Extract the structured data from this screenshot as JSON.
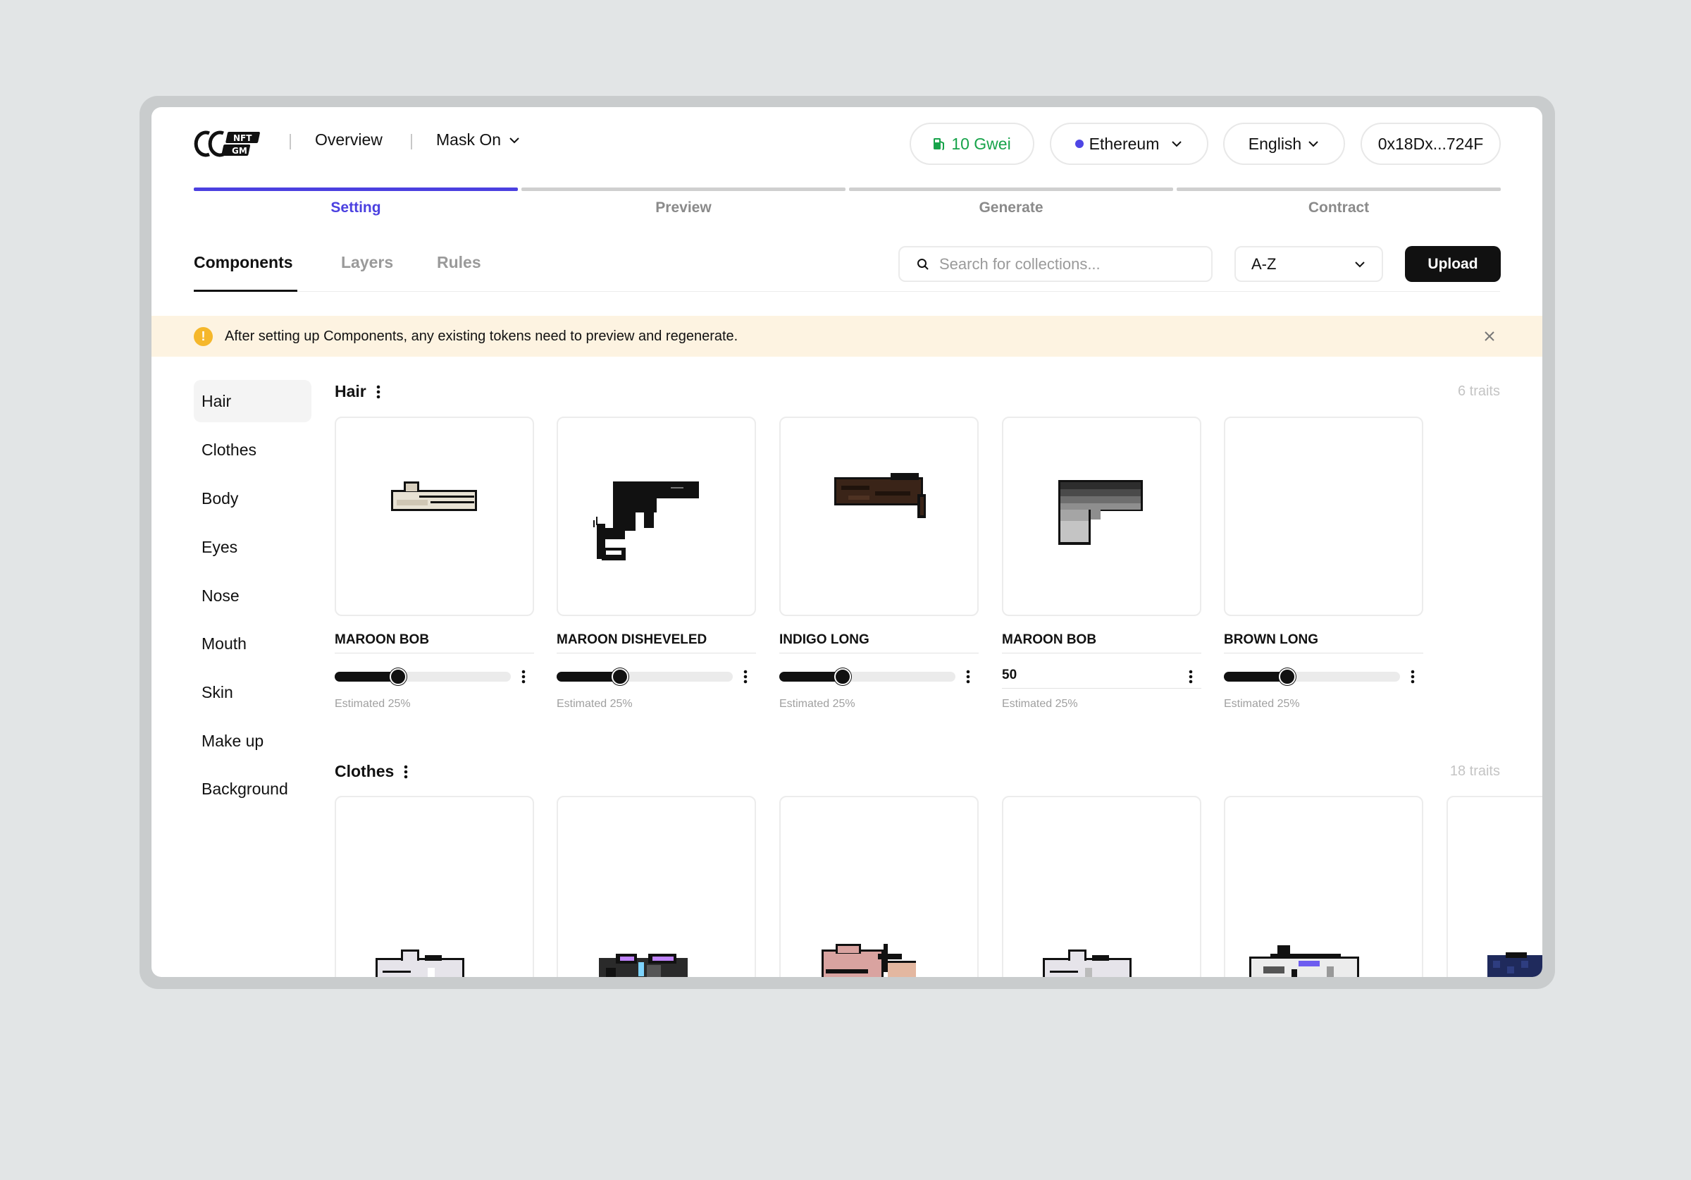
{
  "header": {
    "logo_text": "CC NFT GM",
    "nav": {
      "overview": "Overview",
      "project": "Mask On"
    },
    "gas": "10 Gwei",
    "network": "Ethereum",
    "language": "English",
    "wallet": "0x18Dx...724F"
  },
  "steps": [
    {
      "label": "Setting",
      "active": true
    },
    {
      "label": "Preview",
      "active": false
    },
    {
      "label": "Generate",
      "active": false
    },
    {
      "label": "Contract",
      "active": false
    }
  ],
  "tabs": {
    "components": "Components",
    "layers": "Layers",
    "rules": "Rules"
  },
  "search": {
    "placeholder": "Search for collections..."
  },
  "sort": {
    "value": "A-Z"
  },
  "upload_label": "Upload",
  "notice": {
    "text": "After setting up Components,  any existing tokens need to preview and regenerate."
  },
  "sidebar": {
    "items": [
      {
        "label": "Hair",
        "active": true
      },
      {
        "label": "Clothes"
      },
      {
        "label": "Body"
      },
      {
        "label": "Eyes"
      },
      {
        "label": "Nose"
      },
      {
        "label": "Mouth"
      },
      {
        "label": "Skin"
      },
      {
        "label": "Make up"
      },
      {
        "label": "Background"
      }
    ]
  },
  "sections": [
    {
      "title": "Hair",
      "traits_count": "6 traits",
      "traits": [
        {
          "name": "MAROON BOB",
          "control": "slider",
          "weight": 0.36,
          "estimate": "Estimated 25%"
        },
        {
          "name": "MAROON DISHEVELED",
          "control": "slider",
          "weight": 0.36,
          "estimate": "Estimated 25%"
        },
        {
          "name": "INDIGO LONG",
          "control": "slider",
          "weight": 0.36,
          "estimate": "Estimated 25%"
        },
        {
          "name": "MAROON BOB",
          "control": "input",
          "value": "50",
          "estimate": "Estimated 25%"
        },
        {
          "name": "BROWN LONG",
          "control": "slider",
          "weight": 0.36,
          "estimate": "Estimated 25%"
        }
      ]
    },
    {
      "title": "Clothes",
      "traits_count": "18 traits"
    }
  ]
}
